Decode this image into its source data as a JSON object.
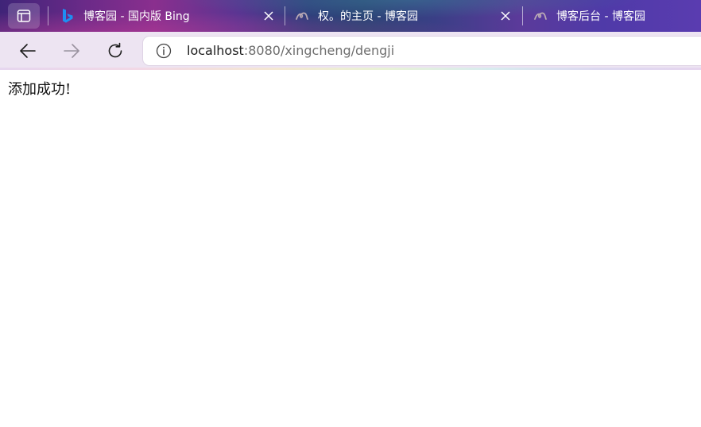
{
  "browser": {
    "tabs": [
      {
        "title": "博客园 - 国内版 Bing",
        "favicon": "bing-icon",
        "active": false
      },
      {
        "title": "权。的主页 - 博客园",
        "favicon": "cnblogs-icon",
        "active": false
      },
      {
        "title": "博客后台 - 博客园",
        "favicon": "cnblogs-icon",
        "active": false
      }
    ],
    "address": {
      "host": "localhost",
      "path": ":8080/xingcheng/dengji"
    }
  },
  "page": {
    "message": "添加成功!"
  },
  "colors": {
    "toolbar_bg": "#ede4f2",
    "bing_blue": "#1e8ff2",
    "text": "#111111"
  }
}
